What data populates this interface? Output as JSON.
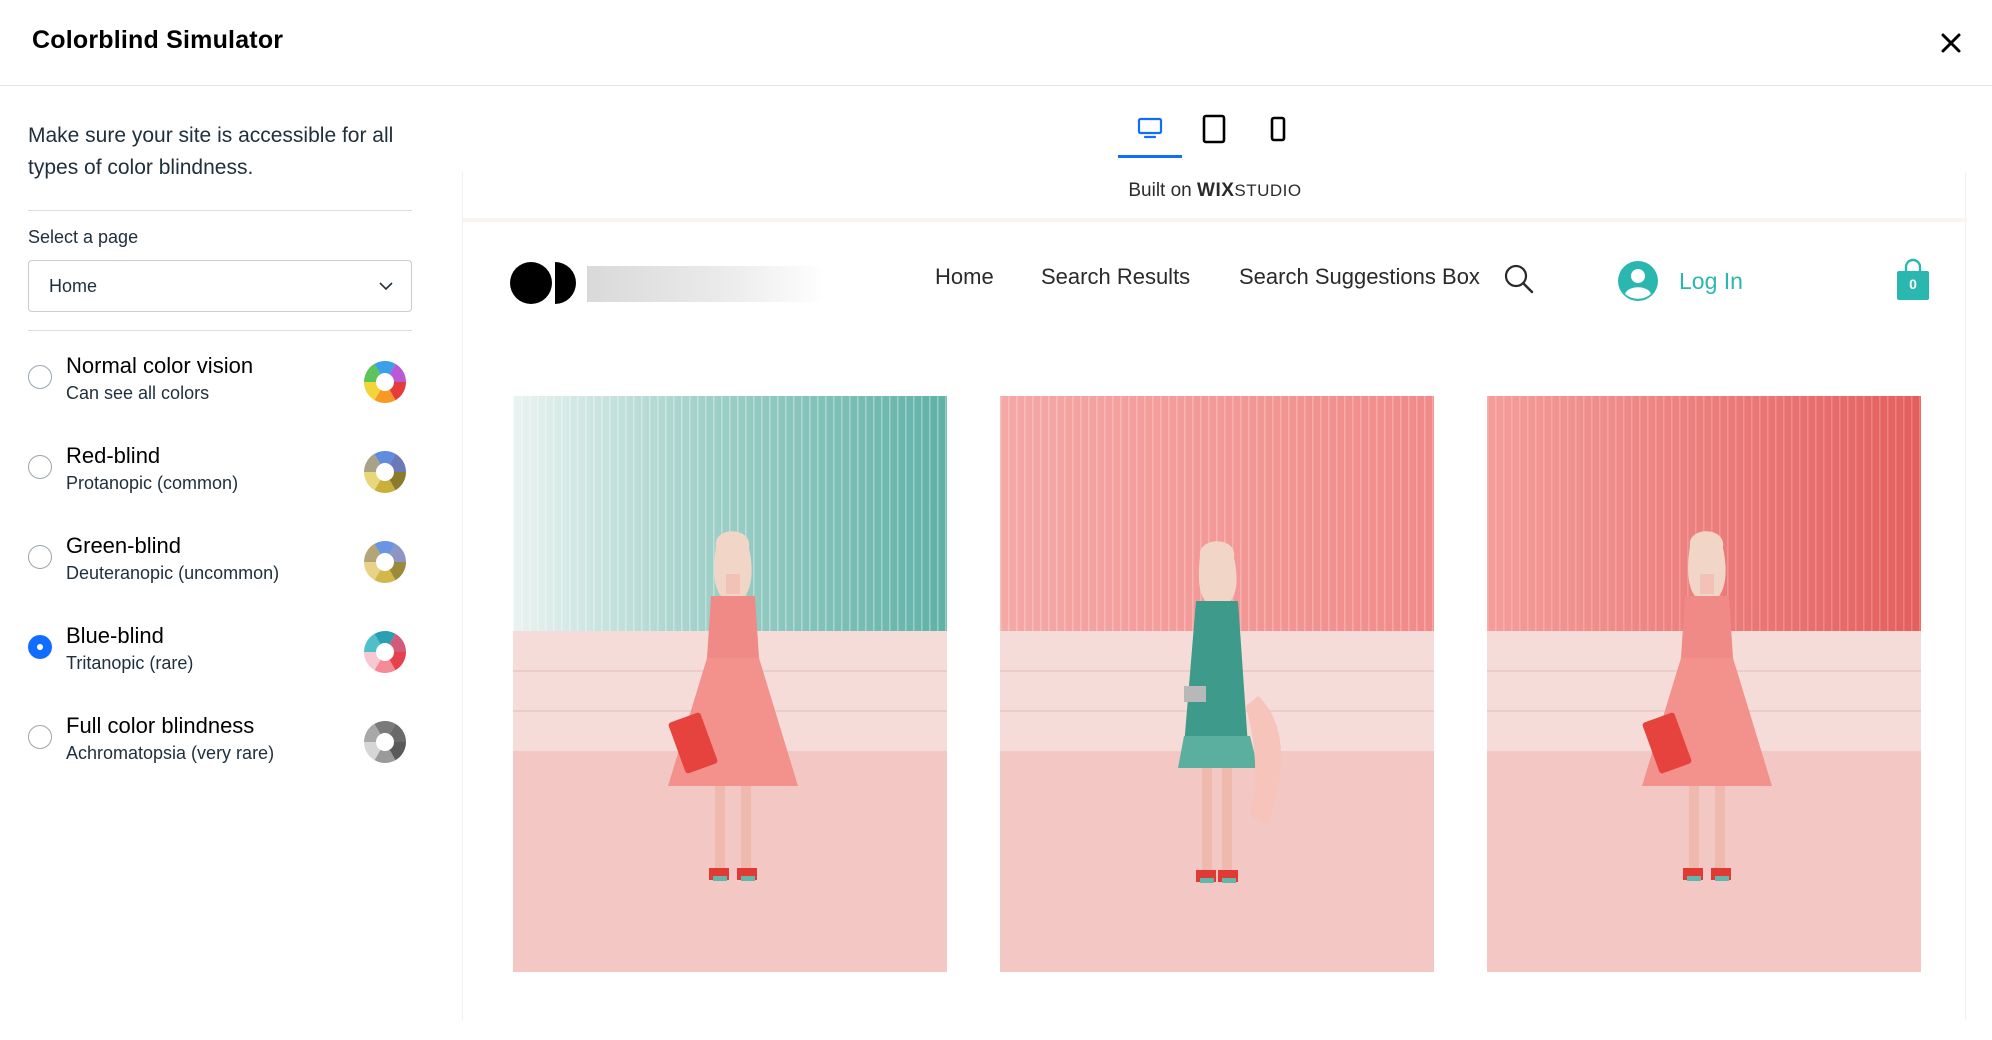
{
  "header": {
    "title": "Colorblind Simulator",
    "close_icon": "close-icon"
  },
  "panel": {
    "intro": "Make sure your site is accessible for all types of color blindness.",
    "select_label": "Select a page",
    "selected_page": "Home",
    "options": [
      {
        "title": "Normal color vision",
        "subtitle": "Can see all colors",
        "checked": false,
        "icon": "color-wheel-normal-icon"
      },
      {
        "title": "Red-blind",
        "subtitle": "Protanopic (common)",
        "checked": false,
        "icon": "color-wheel-protanopic-icon"
      },
      {
        "title": "Green-blind",
        "subtitle": "Deuteranopic (uncommon)",
        "checked": false,
        "icon": "color-wheel-deuteranopic-icon"
      },
      {
        "title": "Blue-blind",
        "subtitle": "Tritanopic (rare)",
        "checked": true,
        "icon": "color-wheel-tritanopic-icon"
      },
      {
        "title": "Full color blindness",
        "subtitle": "Achromatopsia (very rare)",
        "checked": false,
        "icon": "color-wheel-achromatopsia-icon"
      }
    ]
  },
  "preview": {
    "device_tabs": [
      {
        "icon": "desktop-icon",
        "active": true
      },
      {
        "icon": "tablet-icon",
        "active": false
      },
      {
        "icon": "mobile-icon",
        "active": false
      }
    ],
    "built_on_text": "Built on",
    "brand_wix": "WIX",
    "brand_studio": "STUDIO",
    "nav": [
      "Home",
      "Search Results",
      "Search Suggestions Box"
    ],
    "login": "Log In",
    "cart_count": "0"
  },
  "colors": {
    "accent": "#116dff",
    "login": "#2ab7b0"
  }
}
